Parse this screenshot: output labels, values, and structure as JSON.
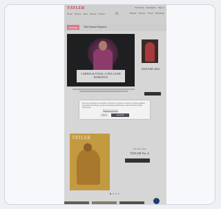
{
  "header": {
    "logo": "TATLER",
    "top_links": [
      "Subscribe",
      "Newsletter",
      "Sign in"
    ],
    "nav": [
      "News",
      "Society",
      "Style",
      "Beauty",
      "Culture"
    ],
    "sub_nav": [
      "Bazaar",
      "Society",
      "Travel",
      "Weddings"
    ]
  },
  "promo_bar": {
    "button": "Subscribe",
    "text": "Tatler Bazaar Magazine"
  },
  "hero": {
    "title": "CARINA & TOGLI: A TEA LAND ROMANCE"
  },
  "side_feature": {
    "title": "BAZAAR 2024"
  },
  "cookie_dialog": {
    "text": "We and our partners use cookies on this site to improve our service, perform analytics, personalize advertising, measure advertising performance, and remember website preferences.",
    "link": "Manage preferences",
    "reject_label": "Reject",
    "accept_label": "Accept all"
  },
  "magazine": {
    "masthead": "TATLER"
  },
  "issue": {
    "label": "The new issue",
    "title": "TATLER No. 6"
  },
  "colors": {
    "brand": "#c23b46",
    "accept_button": "#4a4d52",
    "chat_button": "#1e3f6e"
  }
}
